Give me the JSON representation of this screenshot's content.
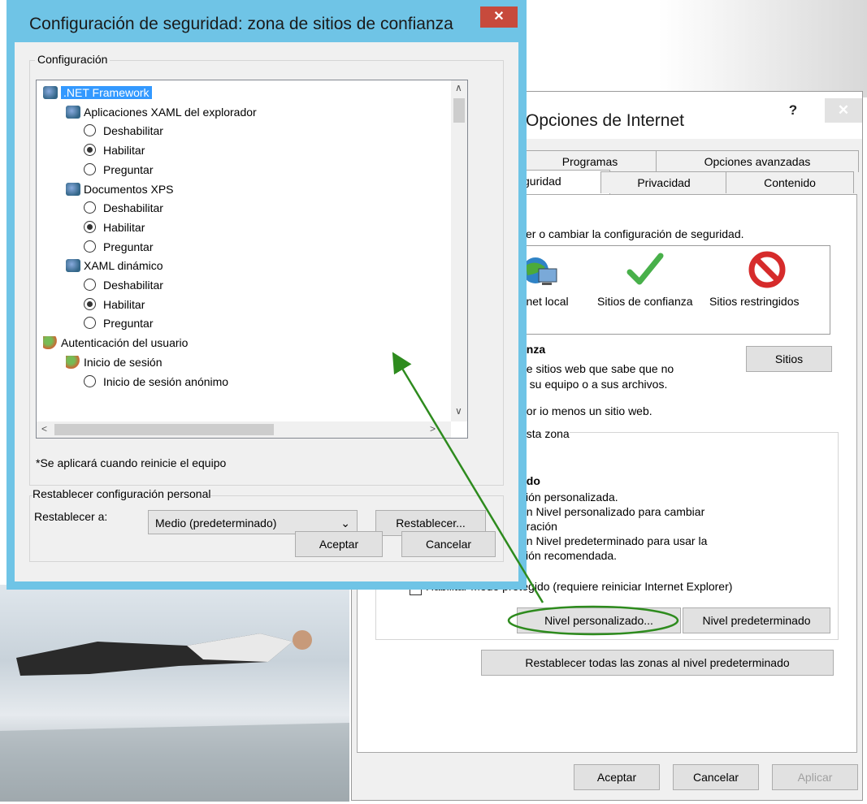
{
  "security_dialog": {
    "title": "Configuración de seguridad: zona de sitios de confianza",
    "close_glyph": "✕",
    "settings_group_label": "Configuración",
    "tree": [
      {
        "kind": "group",
        "icon": "net-framework-icon",
        "label": ".NET Framework",
        "selected": true,
        "indent": 0
      },
      {
        "kind": "group",
        "icon": "net-framework-icon",
        "label": "Aplicaciones XAML del explorador",
        "indent": 1
      },
      {
        "kind": "radio",
        "label": "Deshabilitar",
        "checked": false,
        "indent": 2
      },
      {
        "kind": "radio",
        "label": "Habilitar",
        "checked": true,
        "indent": 2
      },
      {
        "kind": "radio",
        "label": "Preguntar",
        "checked": false,
        "indent": 2
      },
      {
        "kind": "group",
        "icon": "net-framework-icon",
        "label": "Documentos XPS",
        "indent": 1
      },
      {
        "kind": "radio",
        "label": "Deshabilitar",
        "checked": false,
        "indent": 2
      },
      {
        "kind": "radio",
        "label": "Habilitar",
        "checked": true,
        "indent": 2
      },
      {
        "kind": "radio",
        "label": "Preguntar",
        "checked": false,
        "indent": 2
      },
      {
        "kind": "group",
        "icon": "net-framework-icon",
        "label": "XAML dinámico",
        "indent": 1
      },
      {
        "kind": "radio",
        "label": "Deshabilitar",
        "checked": false,
        "indent": 2
      },
      {
        "kind": "radio",
        "label": "Habilitar",
        "checked": true,
        "indent": 2
      },
      {
        "kind": "radio",
        "label": "Preguntar",
        "checked": false,
        "indent": 2
      },
      {
        "kind": "group",
        "icon": "user-auth-icon",
        "label": "Autenticación del usuario",
        "indent": 0
      },
      {
        "kind": "group",
        "icon": "user-auth-icon",
        "label": "Inicio de sesión",
        "indent": 1
      },
      {
        "kind": "radio",
        "label": "Inicio de sesión anónimo",
        "checked": false,
        "indent": 2
      }
    ],
    "restart_note": "*Se aplicará cuando reinicie el equipo",
    "reset_group_label": "Restablecer configuración personal",
    "reset_to_label": "Restablecer a:",
    "reset_combo_value": "Medio (predeterminado)",
    "reset_button": "Restablecer...",
    "ok_button": "Aceptar",
    "cancel_button": "Cancelar"
  },
  "internet_options": {
    "title": "Opciones de Internet",
    "help_glyph": "?",
    "close_glyph": "✕",
    "tabs_row1": [
      "Programas",
      "Opciones avanzadas"
    ],
    "tabs_row2": [
      "guridad",
      "Privacidad",
      "Contenido"
    ],
    "select_zone_text": "ver o cambiar la configuración de seguridad.",
    "zones": [
      {
        "label": "ranet local",
        "icon": "local-intranet-icon"
      },
      {
        "label": "Sitios de confianza",
        "icon": "trusted-sites-check-icon",
        "selected": true
      },
      {
        "label": "Sitios restringidos",
        "icon": "restricted-sites-icon"
      }
    ],
    "zone_heading": "anza",
    "zone_desc_1": "ne sitios web que sabe que no",
    "zone_desc_2": "a su equipo o a sus archivos.",
    "sites_button": "Sitios",
    "sites_note": "oor io menos un sitio web.",
    "security_level_group": "esta zona",
    "level_heading": "ado",
    "level_lines": [
      "ción personalizada.",
      "en Nivel personalizado para cambiar",
      "uración",
      "en Nivel predeterminado para usar la",
      "ción recomendada."
    ],
    "protected_mode_label": "Habilitar Modo protegido (requiere reiniciar Internet Explorer)",
    "custom_level_button": "Nivel personalizado...",
    "default_level_button": "Nivel predeterminado",
    "reset_all_button": "Restablecer todas las zonas al nivel predeterminado",
    "ok_button": "Aceptar",
    "cancel_button": "Cancelar",
    "apply_button": "Aplicar"
  },
  "colors": {
    "accent_frame": "#6fc4e6",
    "selection": "#3399ff",
    "annotation": "#2e8b1e",
    "close_red": "#c74a3c"
  }
}
